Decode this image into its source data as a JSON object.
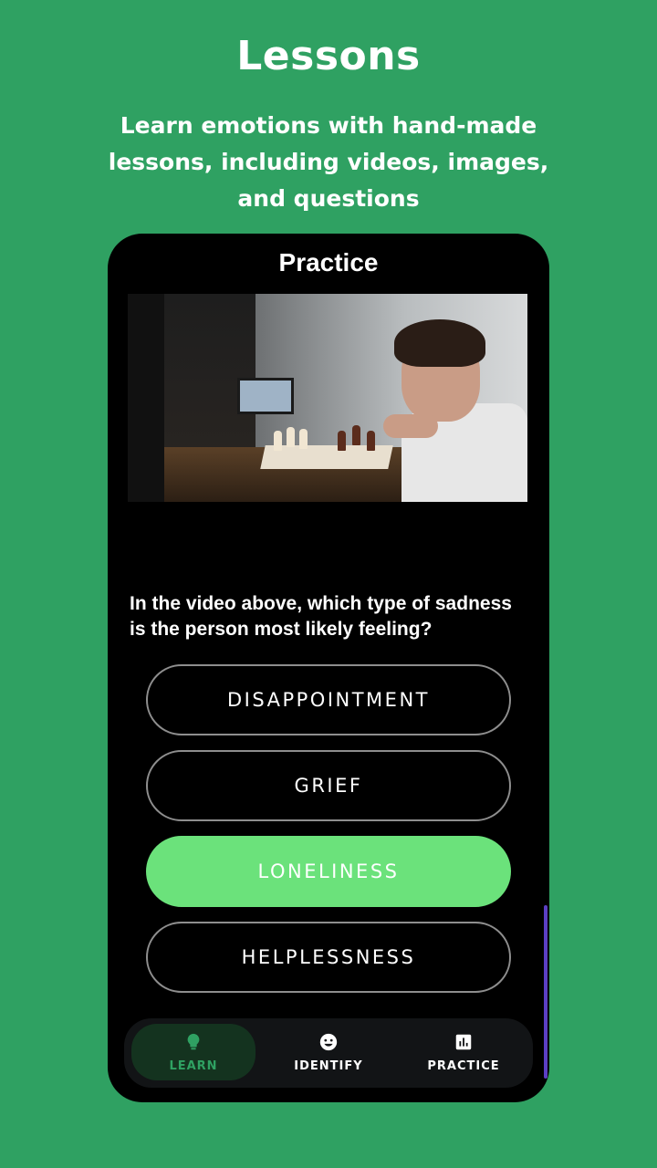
{
  "promo": {
    "title": "Lessons",
    "subtitle": "Learn emotions with hand-made lessons, including videos, images, and questions"
  },
  "screen": {
    "title": "Practice",
    "question": "In the video above, which type of sadness is the person most likely feeling?",
    "answers": [
      {
        "label": "DISAPPOINTMENT",
        "selected": false
      },
      {
        "label": "GRIEF",
        "selected": false
      },
      {
        "label": "LONELINESS",
        "selected": true
      },
      {
        "label": "HELPLESSNESS",
        "selected": false
      }
    ]
  },
  "nav": {
    "items": [
      {
        "label": "LEARN",
        "icon": "lightbulb-icon",
        "active": true
      },
      {
        "label": "IDENTIFY",
        "icon": "smiley-face-icon",
        "active": false
      },
      {
        "label": "PRACTICE",
        "icon": "bar-chart-icon",
        "active": false
      }
    ]
  },
  "colors": {
    "background": "#2fa162",
    "phone": "#000000",
    "selected_answer": "#6be27b",
    "active_nav_bg": "#14331f",
    "active_nav_text": "#2fa162"
  }
}
